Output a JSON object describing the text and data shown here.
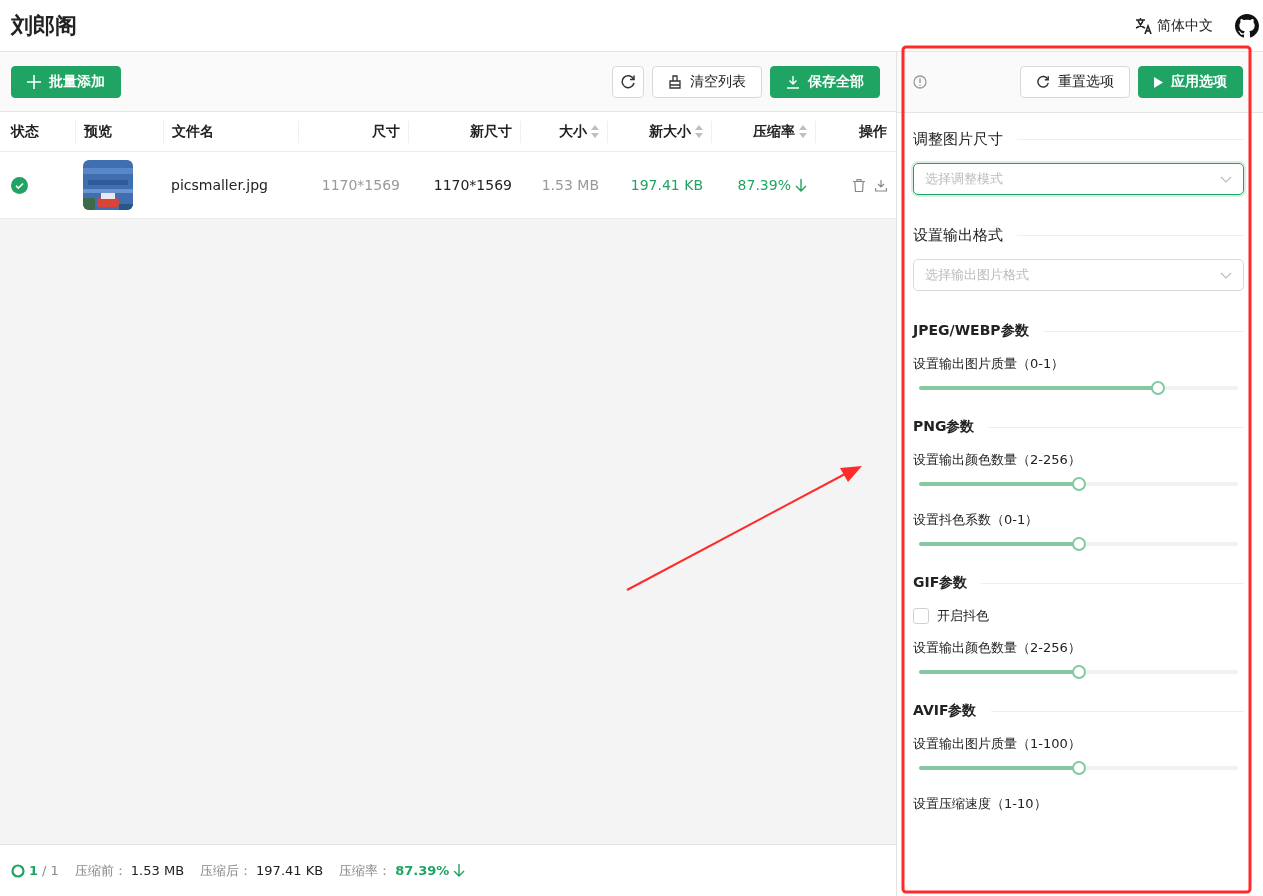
{
  "header": {
    "title": "刘郎阁",
    "language": "简体中文"
  },
  "toolbar": {
    "add_button": "批量添加",
    "clear_button": "清空列表",
    "save_all_button": "保存全部"
  },
  "table": {
    "columns": [
      {
        "label": "状态",
        "sortable": false
      },
      {
        "label": "预览",
        "sortable": false
      },
      {
        "label": "文件名",
        "sortable": false
      },
      {
        "label": "尺寸",
        "sortable": false
      },
      {
        "label": "新尺寸",
        "sortable": false
      },
      {
        "label": "大小",
        "sortable": true
      },
      {
        "label": "新大小",
        "sortable": true
      },
      {
        "label": "压缩率",
        "sortable": true
      },
      {
        "label": "操作",
        "sortable": false
      }
    ],
    "rows": [
      {
        "completed": true,
        "file_name": "picsmaller.jpg",
        "dimensions": "1170*1569",
        "new_dimensions": "1170*1569",
        "size": "1.53 MB",
        "new_size": "197.41 KB",
        "ratio": "87.39%"
      }
    ]
  },
  "footer": {
    "done": "1",
    "total": "/ 1",
    "before_label": "压缩前：",
    "before_value": "1.53 MB",
    "after_label": "压缩后：",
    "after_value": "197.41 KB",
    "ratio_label": "压缩率：",
    "ratio_value": "87.39%"
  },
  "options": {
    "reset_button": "重置选项",
    "apply_button": "应用选项",
    "sections": [
      {
        "title": "调整图片尺寸",
        "bold": false,
        "items": [
          {
            "kind": "select",
            "placeholder": "选择调整模式",
            "focused": true
          }
        ]
      },
      {
        "title": "设置输出格式",
        "bold": false,
        "items": [
          {
            "kind": "select",
            "placeholder": "选择输出图片格式",
            "focused": false
          }
        ]
      },
      {
        "title": "JPEG/WEBP参数",
        "bold": true,
        "items": [
          {
            "kind": "slider",
            "label": "设置输出图片质量（0-1）",
            "level": 0.75
          }
        ]
      },
      {
        "title": "PNG参数",
        "bold": true,
        "items": [
          {
            "kind": "slider",
            "label": "设置输出颜色数量（2-256）",
            "level": 0.5
          },
          {
            "kind": "slider",
            "label": "设置抖色系数（0-1）",
            "level": 0.5
          }
        ]
      },
      {
        "title": "GIF参数",
        "bold": true,
        "items": [
          {
            "kind": "checkbox",
            "label": "开启抖色",
            "checked": false
          },
          {
            "kind": "slider",
            "label": "设置输出颜色数量（2-256）",
            "level": 0.5
          }
        ]
      },
      {
        "title": "AVIF参数",
        "bold": true,
        "items": [
          {
            "kind": "slider",
            "label": "设置输出图片质量（1-100）",
            "level": 0.5
          },
          {
            "kind": "label",
            "label": "设置压缩速度（1-10）"
          }
        ]
      }
    ]
  },
  "annotations": {
    "box": {
      "color": "#ff2a2a"
    },
    "arrow": {
      "color": "#ff2a2a"
    }
  }
}
